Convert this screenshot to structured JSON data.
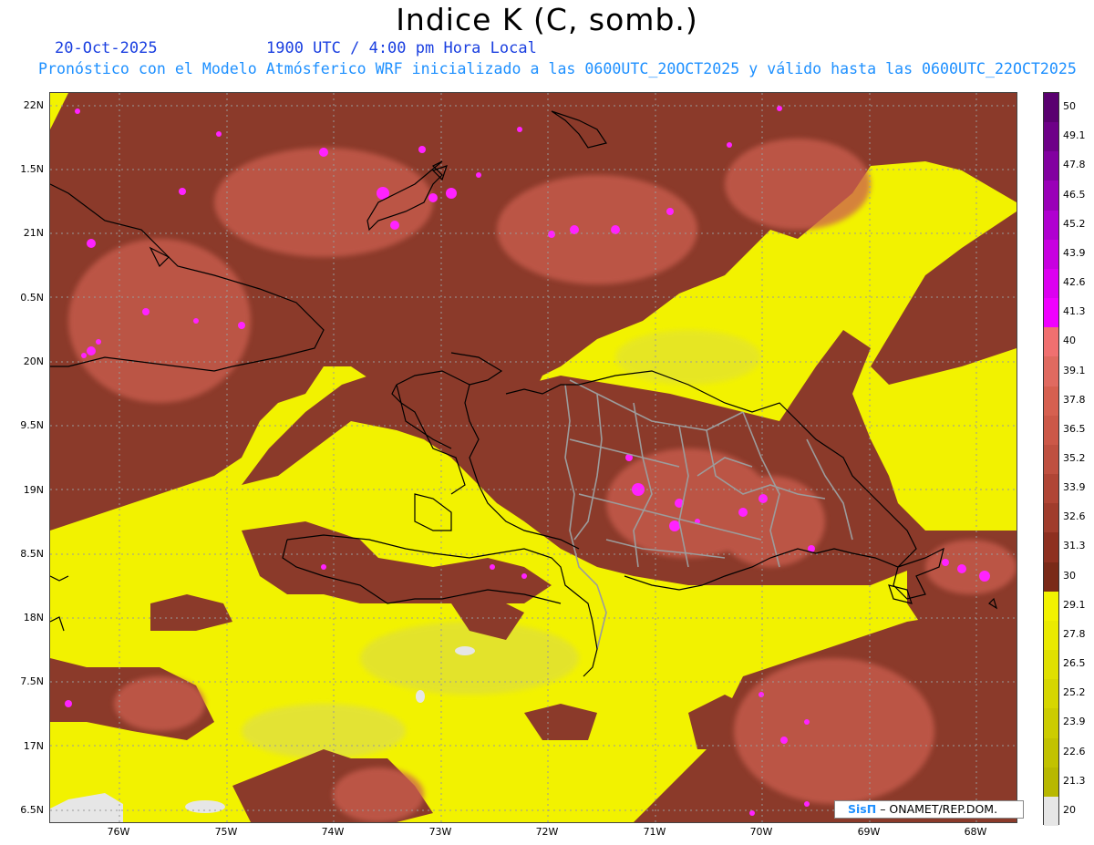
{
  "header": {
    "title": "Indice K (C, somb.)",
    "date": "20-Oct-2025",
    "time": "1900 UTC / 4:00 pm Hora Local",
    "forecast_line": "Pronóstico con el Modelo Atmósferico WRF inicializado a las 0600UTC_20OCT2025 y válido hasta las  0600UTC_22OCT2025"
  },
  "map": {
    "lat_labels": [
      "22N",
      "1.5N",
      "21N",
      "0.5N",
      "20N",
      "9.5N",
      "19N",
      "8.5N",
      "18N",
      "7.5N",
      "17N",
      "6.5N"
    ],
    "lon_labels": [
      "76W",
      "75W",
      "74W",
      "73W",
      "72W",
      "71W",
      "70W",
      "69W",
      "68W"
    ],
    "lat_range": [
      16.5,
      22.0
    ],
    "lon_range": [
      -76.6,
      -67.6
    ],
    "gridlines": "dotted",
    "colors": {
      "low": "#f2f200",
      "mid": "#8b3a2a",
      "high": "#ff00ff",
      "missing": "#e6e6e6",
      "coast": "#000000",
      "provinces": "#999999"
    }
  },
  "legend": {
    "labels": [
      "50",
      "49.1",
      "47.8",
      "46.5",
      "45.2",
      "43.9",
      "42.6",
      "41.3",
      "40",
      "39.1",
      "37.8",
      "36.5",
      "35.2",
      "33.9",
      "32.6",
      "31.3",
      "30",
      "29.1",
      "27.8",
      "26.5",
      "25.2",
      "23.9",
      "22.6",
      "21.3",
      "20"
    ],
    "colors": [
      "#5a0070",
      "#6e0088",
      "#8200a0",
      "#9a00b8",
      "#b000d0",
      "#c800e0",
      "#dc00f0",
      "#f000ff",
      "#f07070",
      "#e06a60",
      "#d66050",
      "#cc5848",
      "#bf5040",
      "#b04535",
      "#a03c2c",
      "#8e3020",
      "#7a2a18",
      "#f2f200",
      "#eaea00",
      "#e0e000",
      "#d6d600",
      "#cccc00",
      "#c2c200",
      "#b8b800",
      "#e6e6e6"
    ]
  },
  "credit": {
    "logo": "SisΠ",
    "text": "– ONAMET/REP.DOM."
  }
}
